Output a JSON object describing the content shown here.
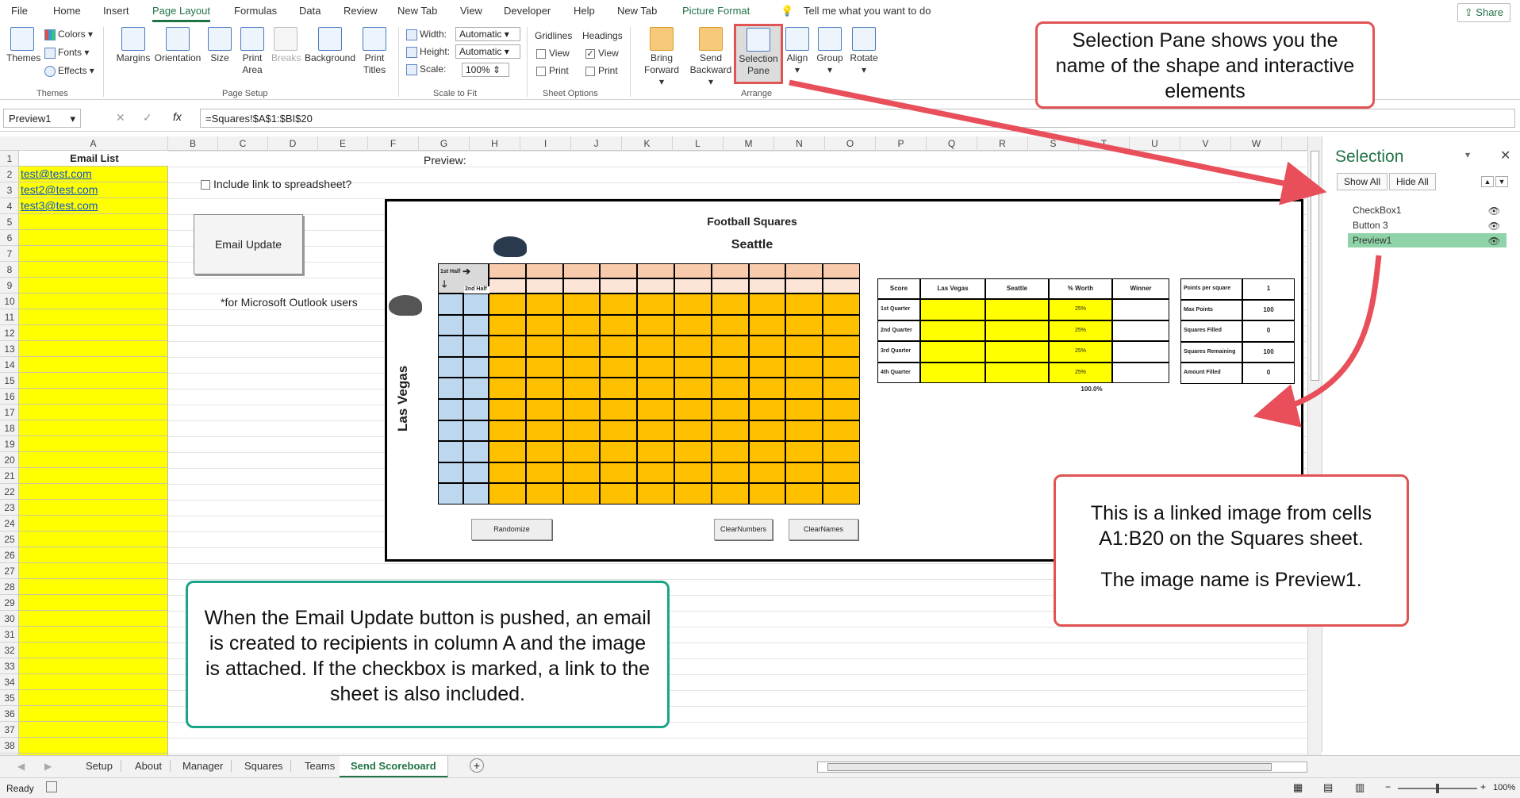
{
  "menu": {
    "items": [
      "File",
      "Home",
      "Insert",
      "Page Layout",
      "Formulas",
      "Data",
      "Review",
      "New Tab",
      "View",
      "Developer",
      "Help",
      "New Tab",
      "Picture Format"
    ],
    "tell_me": "Tell me what you want to do",
    "share": "Share"
  },
  "ribbon": {
    "themes": {
      "themes": "Themes",
      "colors": "Colors",
      "fonts": "Fonts",
      "effects": "Effects",
      "group": "Themes"
    },
    "page_setup": {
      "margins": "Margins",
      "orientation": "Orientation",
      "size": "Size",
      "print_area_1": "Print",
      "print_area_2": "Area",
      "breaks": "Breaks",
      "background": "Background",
      "print_titles_1": "Print",
      "print_titles_2": "Titles",
      "group": "Page Setup"
    },
    "scale": {
      "width_label": "Width:",
      "width_value": "Automatic",
      "height_label": "Height:",
      "height_value": "Automatic",
      "scale_label": "Scale:",
      "scale_value": "100%",
      "group": "Scale to Fit"
    },
    "sheet_options": {
      "gridlines": "Gridlines",
      "headings": "Headings",
      "view": "View",
      "print": "Print",
      "group": "Sheet Options"
    },
    "arrange": {
      "bring_1": "Bring",
      "bring_2": "Forward",
      "send_1": "Send",
      "send_2": "Backward",
      "selection_1": "Selection",
      "selection_2": "Pane",
      "align": "Align",
      "group_btn": "Group",
      "rotate": "Rotate",
      "group": "Arrange"
    }
  },
  "formula_bar": {
    "name_box": "Preview1",
    "fx": "fx",
    "formula": "=Squares!$A$1:$BI$20"
  },
  "columns": [
    "A",
    "B",
    "C",
    "D",
    "E",
    "F",
    "G",
    "H",
    "I",
    "J",
    "K",
    "L",
    "M",
    "N",
    "O",
    "P",
    "Q",
    "R",
    "S",
    "T",
    "U",
    "V",
    "W"
  ],
  "rows": [
    "1",
    "2",
    "3",
    "4",
    "5",
    "6",
    "7",
    "8",
    "9",
    "10",
    "11",
    "12",
    "13",
    "14",
    "15",
    "16",
    "17",
    "18",
    "19",
    "20",
    "21",
    "22",
    "23",
    "24",
    "25",
    "26",
    "27",
    "28",
    "29",
    "30",
    "31",
    "32",
    "33",
    "34",
    "35",
    "36",
    "37",
    "38"
  ],
  "sheet": {
    "email_list_header": "Email List",
    "emails": [
      "test@test.com",
      "test2@test.com",
      "test3@test.com"
    ],
    "include_link": "Include link to spreadsheet?",
    "email_update": "Email Update",
    "outlook_note": "*for Microsoft Outlook users",
    "preview_label": "Preview:"
  },
  "preview": {
    "title": "Football Squares",
    "team_top": "Seattle",
    "team_side": "Las Vegas",
    "first_half": "1st Half",
    "second_half": "2nd Half",
    "randomize": "Randomize",
    "clear_numbers": "ClearNumbers",
    "clear_names": "ClearNames",
    "score_table": {
      "headers": [
        "Score",
        "Las Vegas",
        "Seattle",
        "% Worth",
        "Winner"
      ],
      "rows": [
        {
          "label": "1st Quarter",
          "worth": "25%"
        },
        {
          "label": "2nd Quarter",
          "worth": "25%"
        },
        {
          "label": "3rd Quarter",
          "worth": "25%"
        },
        {
          "label": "4th Quarter",
          "worth": "25%"
        }
      ],
      "total": "100.0%"
    },
    "stats_table": [
      {
        "label": "Points per square",
        "value": "1"
      },
      {
        "label": "Max Points",
        "value": "100"
      },
      {
        "label": "Squares Filled",
        "value": "0"
      },
      {
        "label": "Squares Remaining",
        "value": "100"
      },
      {
        "label": "Amount Filled",
        "value": "0"
      }
    ]
  },
  "callouts": {
    "selection_pane": "Selection Pane shows you the name of the shape and interactive elements",
    "linked_image_1": "This is a linked image from cells A1:B20 on the Squares sheet.",
    "linked_image_2": "The image name is Preview1.",
    "email_update": "When the Email Update button is pushed, an email is created to recipients in column A and the image is attached. If the checkbox is marked, a link to the sheet is also included."
  },
  "selection_pane": {
    "title": "Selection",
    "show_all": "Show All",
    "hide_all": "Hide All",
    "items": [
      "CheckBox1",
      "Button 3",
      "Preview1"
    ],
    "selected": "Preview1"
  },
  "tabs": [
    "Setup",
    "About",
    "Manager",
    "Squares",
    "Teams",
    "Send Scoreboard"
  ],
  "active_tab": "Send Scoreboard",
  "status": {
    "ready": "Ready",
    "zoom": "100%"
  },
  "colors": {
    "excel_green": "#217346",
    "yellow": "#ffff00",
    "orange": "#ffc000",
    "peach": "#fce4d6",
    "light_blue": "#bdd7ee",
    "callout_red": "#e05454",
    "callout_teal": "#1aa58a"
  }
}
